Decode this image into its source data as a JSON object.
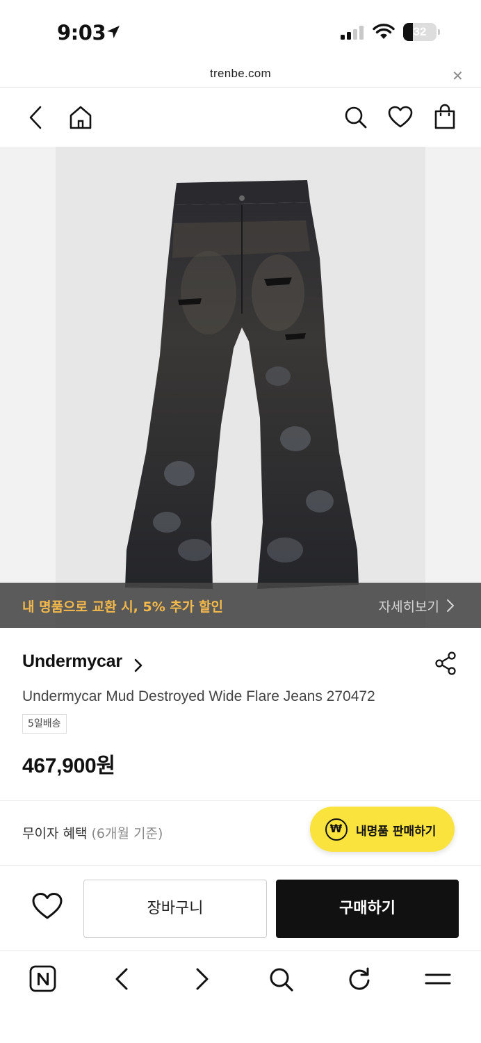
{
  "status": {
    "time": "9:03",
    "battery": "32",
    "icons": [
      "location-arrow-icon",
      "signal-icon",
      "wifi-icon",
      "battery-icon"
    ]
  },
  "browser": {
    "url": "trenbe.com",
    "close_icon": "close-icon"
  },
  "nav": {
    "icons": [
      "back-icon",
      "home-icon",
      "search-icon",
      "heart-icon",
      "shopping-bag-icon"
    ]
  },
  "promo": {
    "text": "내 명품으로 교환 시, 5% 추가 할인",
    "link": "자세히보기",
    "text_color": "#f5b94a"
  },
  "product": {
    "brand": "Undermycar",
    "title": "Undermycar Mud Destroyed Wide Flare Jeans 270472",
    "shipping": "5일배송",
    "price": "467,900원"
  },
  "benefits": {
    "label": "무이자 혜택",
    "sub": "(6개월 기준)"
  },
  "sell": {
    "icon_glyph": "₩",
    "label": "내명품 판매하기",
    "color": "#fbe33e"
  },
  "actions": {
    "cart": "장바구니",
    "buy": "구매하기"
  },
  "toolbar": {
    "icons": [
      "naver-icon",
      "back-arrow-icon",
      "forward-arrow-icon",
      "search-icon",
      "refresh-icon",
      "menu-icon"
    ]
  }
}
